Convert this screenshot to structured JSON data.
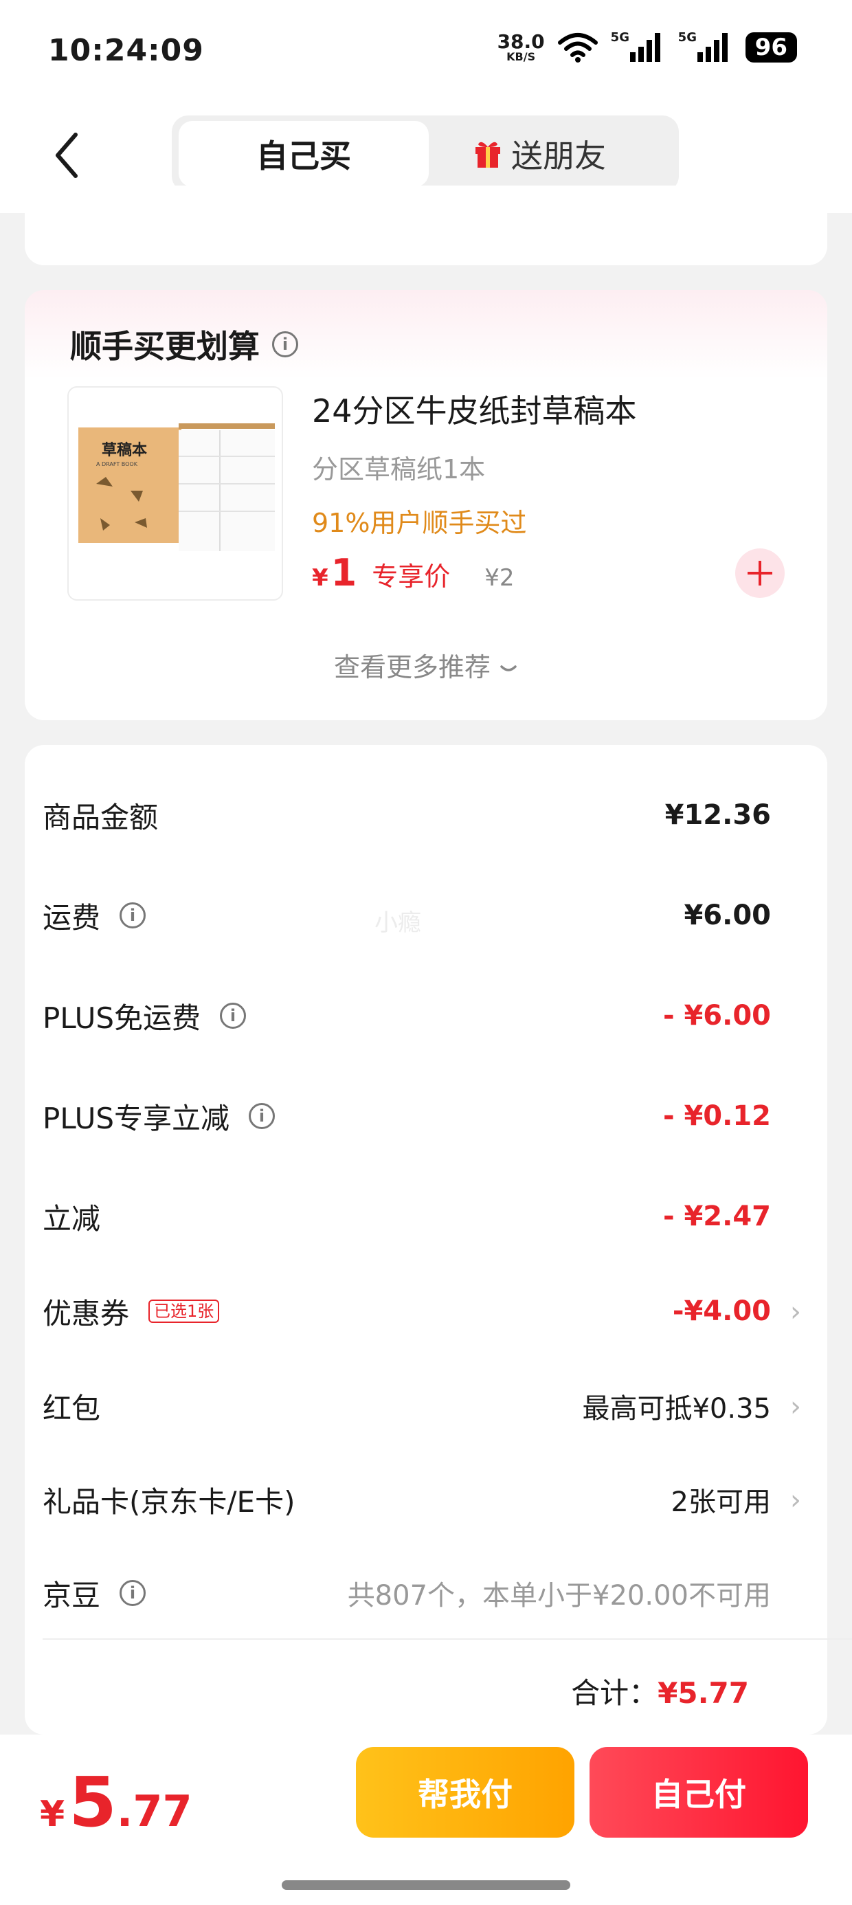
{
  "status_bar": {
    "time": "10:24:09",
    "net_speed": "38.0",
    "net_unit": "KB/S",
    "sim1": "5G",
    "sim2": "5G",
    "battery": "96"
  },
  "header": {
    "tab_self": "自己买",
    "tab_gift": "送朋友"
  },
  "recommend": {
    "title": "顺手买更划算",
    "product": {
      "name": "24分区牛皮纸封草稿本",
      "spec": "分区草稿纸1本",
      "stat": "91%用户顺手买过",
      "currency": "¥",
      "price": "1",
      "price_tag": "专享价",
      "orig_price": "¥2",
      "thumb_title": "草稿本",
      "thumb_sub": "A DRAFT BOOK"
    },
    "more_label": "查看更多推荐"
  },
  "summary": {
    "rows": [
      {
        "label": "商品金额",
        "value": "¥12.36"
      },
      {
        "label": "运费",
        "value": "¥6.00"
      },
      {
        "label": "PLUS免运费",
        "value": "- ¥6.00"
      },
      {
        "label": "PLUS专享立减",
        "value": "- ¥0.12"
      },
      {
        "label": "立减",
        "value": "- ¥2.47"
      },
      {
        "label": "优惠券",
        "tag": "已选1张",
        "value": "-¥4.00"
      },
      {
        "label": "红包",
        "value": "最高可抵¥0.35"
      },
      {
        "label": "礼品卡(京东卡/E卡)",
        "value": "2张可用"
      },
      {
        "label": "京豆",
        "value": "共807个，本单小于¥20.00不可用"
      }
    ],
    "total_label": "合计：",
    "total_value": "¥5.77",
    "watermark": "小瘾"
  },
  "bottom": {
    "yen": "¥",
    "int": "5",
    "dec": ".77",
    "help_pay": "帮我付",
    "self_pay": "自己付"
  },
  "colors": {
    "accent_red": "#e8242b",
    "orange": "#e08a1a",
    "help_btn": "#ffb300",
    "pay_btn": "#ff2a40"
  }
}
